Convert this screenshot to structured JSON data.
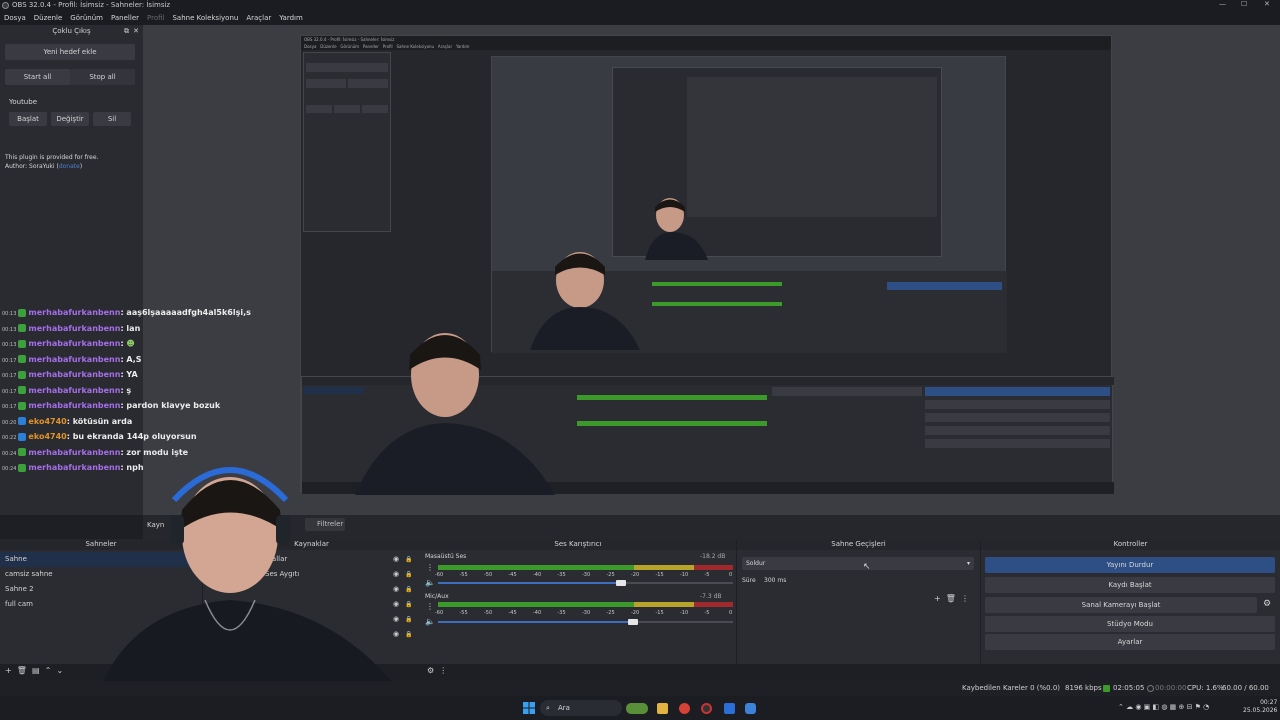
{
  "window": {
    "title": "OBS 32.0.4 - Profil: İsimsiz - Sahneler: İsimsiz",
    "controls": [
      "—",
      "☐",
      "✕"
    ]
  },
  "menu": [
    "Dosya",
    "Düzenle",
    "Görünüm",
    "Paneller",
    "Profil",
    "Sahne Koleksiyonu",
    "Araçlar",
    "Yardım"
  ],
  "multi_rtmp": {
    "title": "Çoklu Çıkış",
    "add_target": "Yeni hedef ekle",
    "start_all": "Start all",
    "stop_all": "Stop all",
    "target_name": "Youtube",
    "start": "Başlat",
    "edit": "Değiştir",
    "delete": "Sil",
    "info_line1": "This plugin is provided for free.",
    "info_author": "Author: SoraYuki (",
    "info_link": "donate",
    "info_close": ")"
  },
  "chat": [
    {
      "time": "00:13",
      "user": "merhabafurkanbenn",
      "msg": ": aaş6lşaaaaadfgh4al5k6lşi,s",
      "color": "purple"
    },
    {
      "time": "00:13",
      "user": "merhabafurkanbenn",
      "msg": ": lan",
      "color": "purple"
    },
    {
      "time": "00:13",
      "user": "merhabafurkanbenn",
      "msg": ": ",
      "emote": true,
      "color": "purple"
    },
    {
      "time": "00:17",
      "user": "merhabafurkanbenn",
      "msg": ": A,S",
      "color": "purple"
    },
    {
      "time": "00:17",
      "user": "merhabafurkanbenn",
      "msg": ": YA",
      "color": "purple"
    },
    {
      "time": "00:17",
      "user": "merhabafurkanbenn",
      "msg": ": ş",
      "color": "purple"
    },
    {
      "time": "00:17",
      "user": "merhabafurkanbenn",
      "msg": ": pardon klavye bozuk",
      "color": "purple"
    },
    {
      "time": "00:20",
      "user": "eko4740",
      "msg": ": kötüsün arda",
      "color": "orange"
    },
    {
      "time": "00:22",
      "user": "eko4740",
      "msg": ": bu ekranda 144p oluyorsun",
      "color": "orange"
    },
    {
      "time": "00:24",
      "user": "merhabafurkanbenn",
      "msg": ": zor modu işte",
      "color": "purple"
    },
    {
      "time": "00:24",
      "user": "merhabafurkanbenn",
      "msg": ": nph",
      "color": "purple"
    }
  ],
  "tabs": {
    "sources_tab": "Kayn",
    "filters_tab": "Filtreler",
    "sources_hidden": "ler"
  },
  "scenes": {
    "title": "Sahneler",
    "items": [
      "Sahne",
      "camsiz sahne",
      "Sahne 2",
      "full cam"
    ],
    "selected": 0
  },
  "sources": {
    "title": "Kaynaklar",
    "items": [
      "krallar",
      "Ses Aygıtı",
      "",
      "",
      "",
      ""
    ]
  },
  "mixer": {
    "title": "Ses Karıştırıcı",
    "channels": [
      {
        "name": "Masaüstü Ses",
        "db": "-18.2 dB",
        "level": 0.62
      },
      {
        "name": "Mic/Aux",
        "db": "-7.3 dB",
        "level": 0.66
      }
    ],
    "ticks": [
      "-60",
      "-55",
      "-50",
      "-45",
      "-40",
      "-35",
      "-30",
      "-25",
      "-20",
      "-15",
      "-10",
      "-5",
      "0"
    ]
  },
  "transitions": {
    "title": "Sahne Geçişleri",
    "selected": "Soldur",
    "duration_label": "Süre",
    "duration_value": "300 ms"
  },
  "controls": {
    "title": "Kontroller",
    "stop_stream": "Yayını Durdur",
    "start_record": "Kaydı Başlat",
    "start_vcam": "Sanal Kamerayı Başlat",
    "studio_mode": "Stüdyo Modu",
    "settings": "Ayarlar"
  },
  "status": {
    "dropped": "Kaybedilen Kareler 0 (%0.0)",
    "bitrate": "8196 kbps",
    "stream_time": "02:05:05",
    "rec_time": "00:00:00",
    "cpu": "CPU: 1.6%",
    "fps": "60.00 / 60.00 FPS"
  },
  "taskbar": {
    "search": "Ara",
    "clock": "00:27",
    "date": "25.05.2026"
  },
  "colors": {
    "accent": "#2d4f86",
    "user_purple": "#a46ee8",
    "user_orange": "#e0922a",
    "meter_green": "#3b9a2a",
    "meter_yellow": "#b6a52a",
    "meter_red": "#a0292d"
  }
}
